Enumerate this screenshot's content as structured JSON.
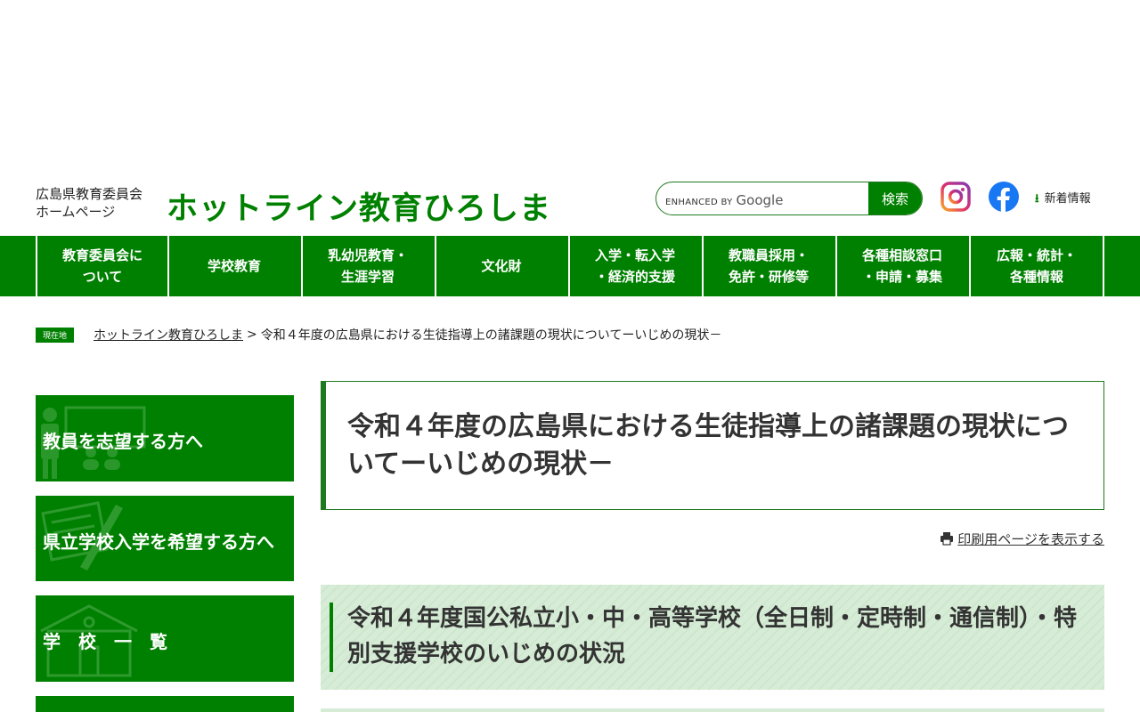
{
  "header": {
    "site_sub_line1": "広島県教育委員会",
    "site_sub_line2": "ホームページ",
    "site_title": "ホットライン教育ひろしま",
    "search": {
      "enhanced_label": "ENHANCED BY",
      "google_label": "Google",
      "button_label": "検索"
    },
    "news_label": "新着情報"
  },
  "gnav": {
    "items": [
      {
        "label": "教育委員会に\nついて"
      },
      {
        "label": "学校教育"
      },
      {
        "label": "乳幼児教育・\n生涯学習"
      },
      {
        "label": "文化財"
      },
      {
        "label": "入学・転入学\n・経済的支援"
      },
      {
        "label": "教職員採用・\n免許・研修等"
      },
      {
        "label": "各種相談窓口\n・申請・募集"
      },
      {
        "label": "広報・統計・\n各種情報"
      }
    ]
  },
  "breadcrumb": {
    "tag": "現在地",
    "home": "ホットライン教育ひろしま",
    "separator": ">",
    "current": "令和４年度の広島県における生徒指導上の諸課題の現状についてーいじめの現状－"
  },
  "sidebar": {
    "banners": [
      {
        "label": "教員を志望する方へ"
      },
      {
        "label": "県立学校入学を希望する方へ"
      },
      {
        "label": "学　校　一　覧"
      }
    ]
  },
  "main": {
    "title": "令和４年度の広島県における生徒指導上の諸課題の現状についてーいじめの現状－",
    "print_label": "印刷用ページを表示する",
    "section_heading": "令和４年度国公私立小・中・高等学校（全日制・定時制・通信制）・特別支援学校のいじめの状況"
  },
  "colors": {
    "brand_green": "#008000",
    "heading_bg": "#d6ecd6"
  }
}
